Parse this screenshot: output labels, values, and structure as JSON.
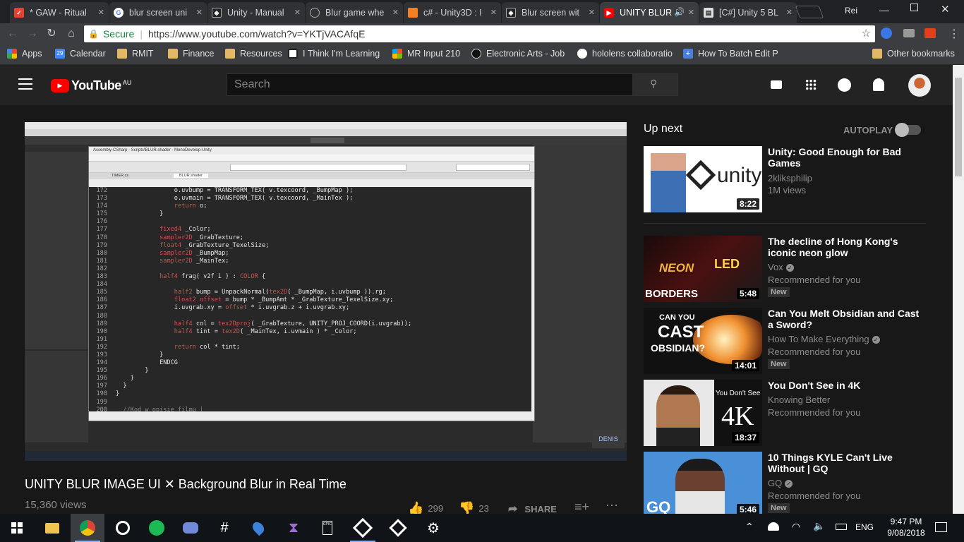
{
  "browser": {
    "tabs": [
      {
        "label": "* GAW - Ritual",
        "favicon": "todoist",
        "color": "#e44332"
      },
      {
        "label": "blur screen uni",
        "favicon": "google",
        "color": "#ffffff"
      },
      {
        "label": "Unity - Manual",
        "favicon": "unity",
        "color": "#222222"
      },
      {
        "label": "Blur game whe",
        "favicon": "unity-answers",
        "color": "#333333"
      },
      {
        "label": "c# - Unity3D : I",
        "favicon": "stackoverflow",
        "color": "#f48024"
      },
      {
        "label": "Blur screen wit",
        "favicon": "unity",
        "color": "#222222"
      },
      {
        "label": "UNITY BLUR",
        "favicon": "youtube",
        "color": "#ff0000"
      },
      {
        "label": "[C#] Unity 5 BL",
        "favicon": "document",
        "color": "#dddddd"
      }
    ],
    "profile": "Rei",
    "url_secure_label": "Secure",
    "url": "https://www.youtube.com/watch?v=YKTjVACAfqE",
    "bookmarks": [
      {
        "label": "Apps"
      },
      {
        "label": "Calendar"
      },
      {
        "label": "RMIT"
      },
      {
        "label": "Finance"
      },
      {
        "label": "Resources"
      },
      {
        "label": "I Think I'm Learning"
      },
      {
        "label": "MR Input 210"
      },
      {
        "label": "Electronic Arts - Job"
      },
      {
        "label": "hololens collaboratio"
      },
      {
        "label": "How To Batch Edit P"
      },
      {
        "label": "Other bookmarks"
      }
    ],
    "calendar_day": "29"
  },
  "youtube": {
    "logo_text": "YouTube",
    "region": "AU",
    "search_placeholder": "Search",
    "video": {
      "title": "UNITY BLUR IMAGE UI ✕ Background Blur in Real Time",
      "views": "15,360 views",
      "likes": "299",
      "dislikes": "23",
      "share_label": "SHARE"
    },
    "player_code": {
      "window_title": "Assembly-CSharp - Scripts\\BLUR.shader - MonoDevelop-Unity",
      "tab1": "TIMER.cs",
      "tab2": "BLUR.shader",
      "lines": [
        {
          "n": "172",
          "t": "                o.uvbump = TRANSFORM_TEX( v.texcoord, _BumpMap );"
        },
        {
          "n": "173",
          "t": "                o.uvmain = TRANSFORM_TEX( v.texcoord, _MainTex );"
        },
        {
          "n": "174",
          "t": "                return o;"
        },
        {
          "n": "175",
          "t": "            }"
        },
        {
          "n": "176",
          "t": ""
        },
        {
          "n": "177",
          "t": "            fixed4 _Color;"
        },
        {
          "n": "178",
          "t": "            sampler2D _GrabTexture;"
        },
        {
          "n": "179",
          "t": "            float4 _GrabTexture_TexelSize;"
        },
        {
          "n": "180",
          "t": "            sampler2D _BumpMap;"
        },
        {
          "n": "181",
          "t": "            sampler2D _MainTex;"
        },
        {
          "n": "182",
          "t": ""
        },
        {
          "n": "183",
          "t": "            half4 frag( v2f i ) : COLOR {"
        },
        {
          "n": "184",
          "t": ""
        },
        {
          "n": "185",
          "t": "                half2 bump = UnpackNormal(tex2D( _BumpMap, i.uvbump )).rg;"
        },
        {
          "n": "186",
          "t": "                float2 offset = bump * _BumpAmt * _GrabTexture_TexelSize.xy;"
        },
        {
          "n": "187",
          "t": "                i.uvgrab.xy = offset * i.uvgrab.z + i.uvgrab.xy;"
        },
        {
          "n": "188",
          "t": ""
        },
        {
          "n": "189",
          "t": "                half4 col = tex2Dproj( _GrabTexture, UNITY_PROJ_COORD(i.uvgrab));"
        },
        {
          "n": "190",
          "t": "                half4 tint = tex2D( _MainTex, i.uvmain ) * _Color;"
        },
        {
          "n": "191",
          "t": ""
        },
        {
          "n": "192",
          "t": "                return col * tint;"
        },
        {
          "n": "193",
          "t": "            }"
        },
        {
          "n": "194",
          "t": "            ENDCG"
        },
        {
          "n": "195",
          "t": "        }"
        },
        {
          "n": "196",
          "t": "    }"
        },
        {
          "n": "197",
          "t": "  }"
        },
        {
          "n": "198",
          "t": "}"
        },
        {
          "n": "199",
          "t": ""
        },
        {
          "n": "200",
          "t": "  //Kod w opisie filmu |"
        }
      ],
      "watermark": "DENIS"
    },
    "up_next_label": "Up next",
    "autoplay_label": "AUTOPLAY",
    "recommendations": [
      {
        "title": "Unity: Good Enough for Bad Games",
        "channel": "2kliksphilip",
        "meta": "1M views",
        "duration": "8:22",
        "verified": false,
        "new": false
      },
      {
        "title": "The decline of Hong Kong's iconic neon glow",
        "channel": "Vox",
        "meta": "Recommended for you",
        "duration": "5:48",
        "verified": true,
        "new": true,
        "new_label": "New"
      },
      {
        "title": "Can You Melt Obsidian and Cast a Sword?",
        "channel": "How To Make Everything",
        "meta": "Recommended for you",
        "duration": "14:01",
        "verified": true,
        "new": true,
        "new_label": "New"
      },
      {
        "title": "You Don't See in 4K",
        "channel": "Knowing Better",
        "meta": "Recommended for you",
        "duration": "18:37",
        "verified": false,
        "new": false
      },
      {
        "title": "10 Things KYLE Can't Live Without | GQ",
        "channel": "GQ",
        "meta": "Recommended for you",
        "duration": "5:46",
        "verified": true,
        "new": true,
        "new_label": "New"
      }
    ],
    "thumb_text": {
      "unity": "unity",
      "neon": "NEON",
      "led": "LED",
      "borders": "BORDERS",
      "can_you": "CAN YOU",
      "cast": "CAST",
      "obsidian": "OBSIDIAN?",
      "dont_see": "You Don't See in",
      "fourk": "4K",
      "gq": "GQ"
    }
  },
  "taskbar": {
    "language": "ENG",
    "time": "9:47 PM",
    "date": "9/08/2018"
  }
}
